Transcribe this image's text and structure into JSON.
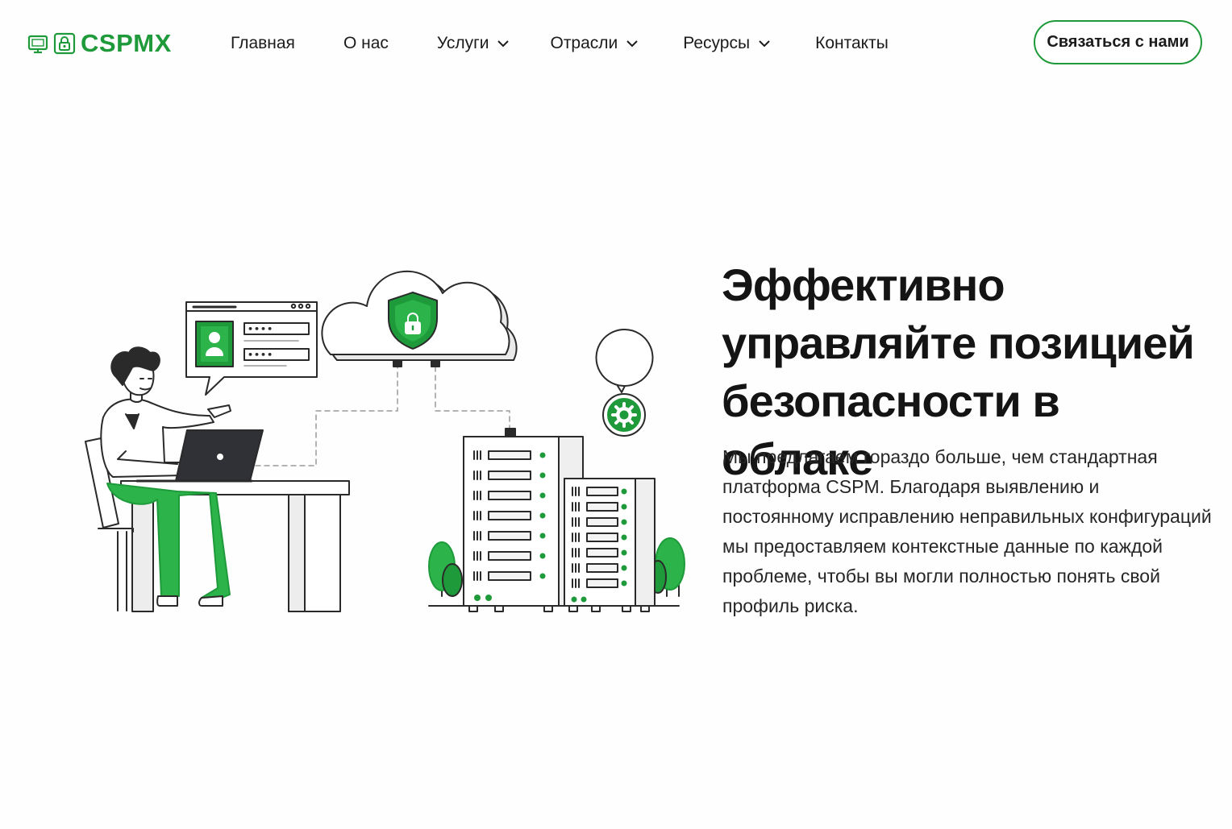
{
  "brand": {
    "name": "CSPMX",
    "accent_color": "#1e9a3a",
    "icons": [
      "monitor-icon",
      "lock-icon"
    ]
  },
  "nav": {
    "items": [
      {
        "label": "Главная",
        "has_dropdown": false
      },
      {
        "label": "О нас",
        "has_dropdown": false
      },
      {
        "label": "Услуги",
        "has_dropdown": true
      },
      {
        "label": "Отрасли",
        "has_dropdown": true
      },
      {
        "label": "Ресурсы",
        "has_dropdown": true
      },
      {
        "label": "Контакты",
        "has_dropdown": false
      }
    ],
    "cta_label": "Связаться с нами"
  },
  "hero": {
    "title": "Эффективно управляйте позицией безопасности в облаке",
    "description": "Мы предлагаем гораздо больше, чем стандартная платформа CSPM. Благодаря выявлению и постоянному исправлению неправильных конфигураций мы предоставляем контекстные данные по каждой проблеме, чтобы вы могли полностью понять свой профиль риска.",
    "illustration": {
      "icons": [
        "user-icon",
        "shield-lock-icon",
        "gear-icon",
        "laptop-icon",
        "server-icon",
        "tree-icon",
        "cloud-icon"
      ],
      "password_mask": "••••"
    }
  }
}
